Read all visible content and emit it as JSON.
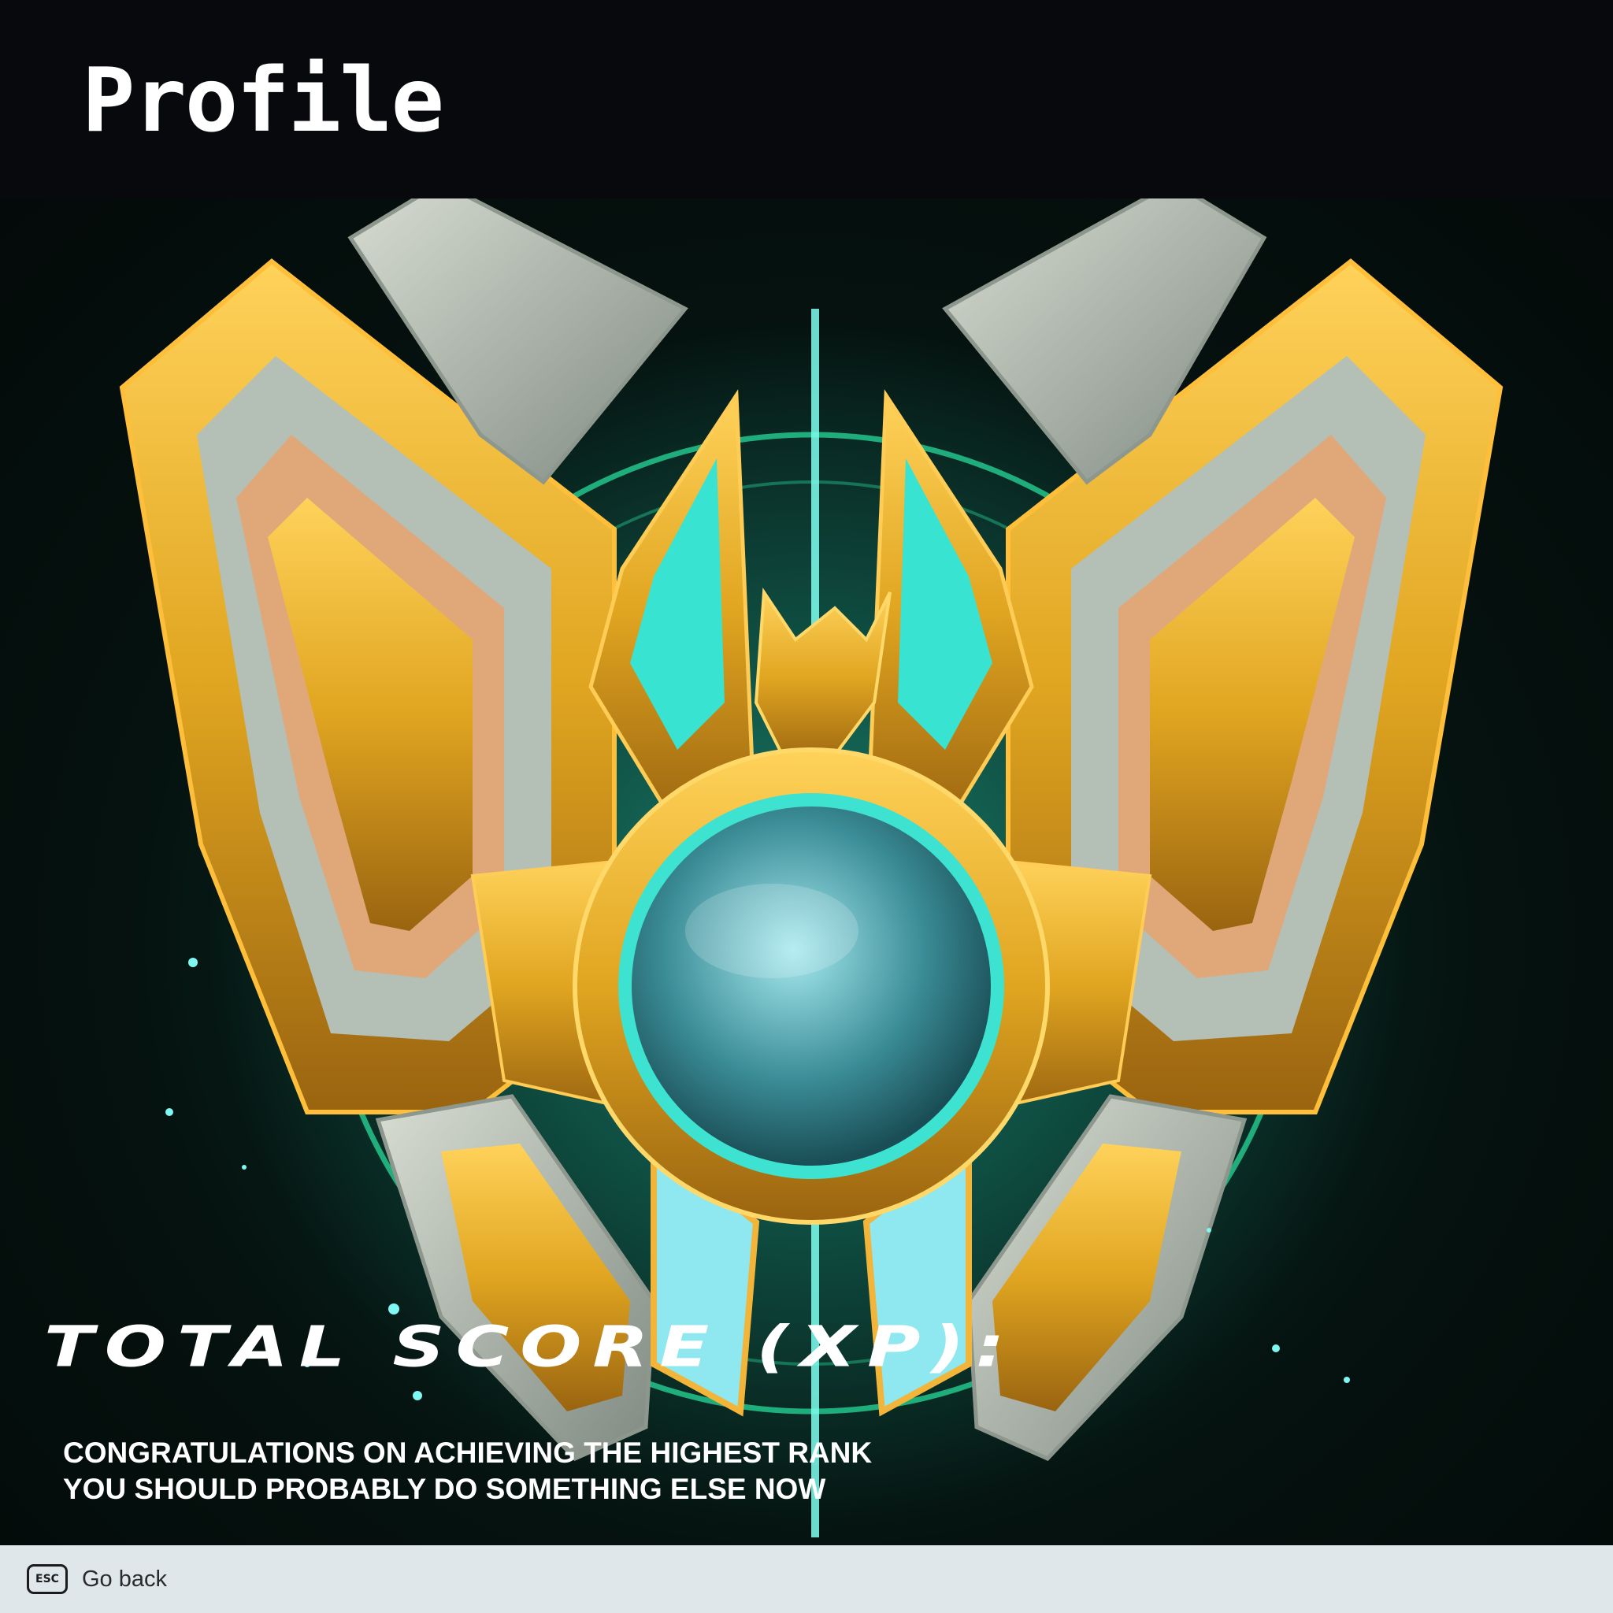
{
  "header": {
    "title": "Profile"
  },
  "score": {
    "label": "TOTAL SCORE (XP):",
    "value": ""
  },
  "message": {
    "line1": "CONGRATULATIONS ON ACHIEVING THE HIGHEST RANK",
    "line2": "YOU SHOULD PROBABLY DO SOMETHING ELSE NOW"
  },
  "footer": {
    "key": "ESC",
    "label": "Go back"
  },
  "icons": {
    "emblem": "rank-emblem-icon"
  },
  "colors": {
    "gold": "#e0a520",
    "teal": "#3de3d0",
    "silver": "#b4bfb6",
    "footer_bg": "#dfe7eb"
  }
}
